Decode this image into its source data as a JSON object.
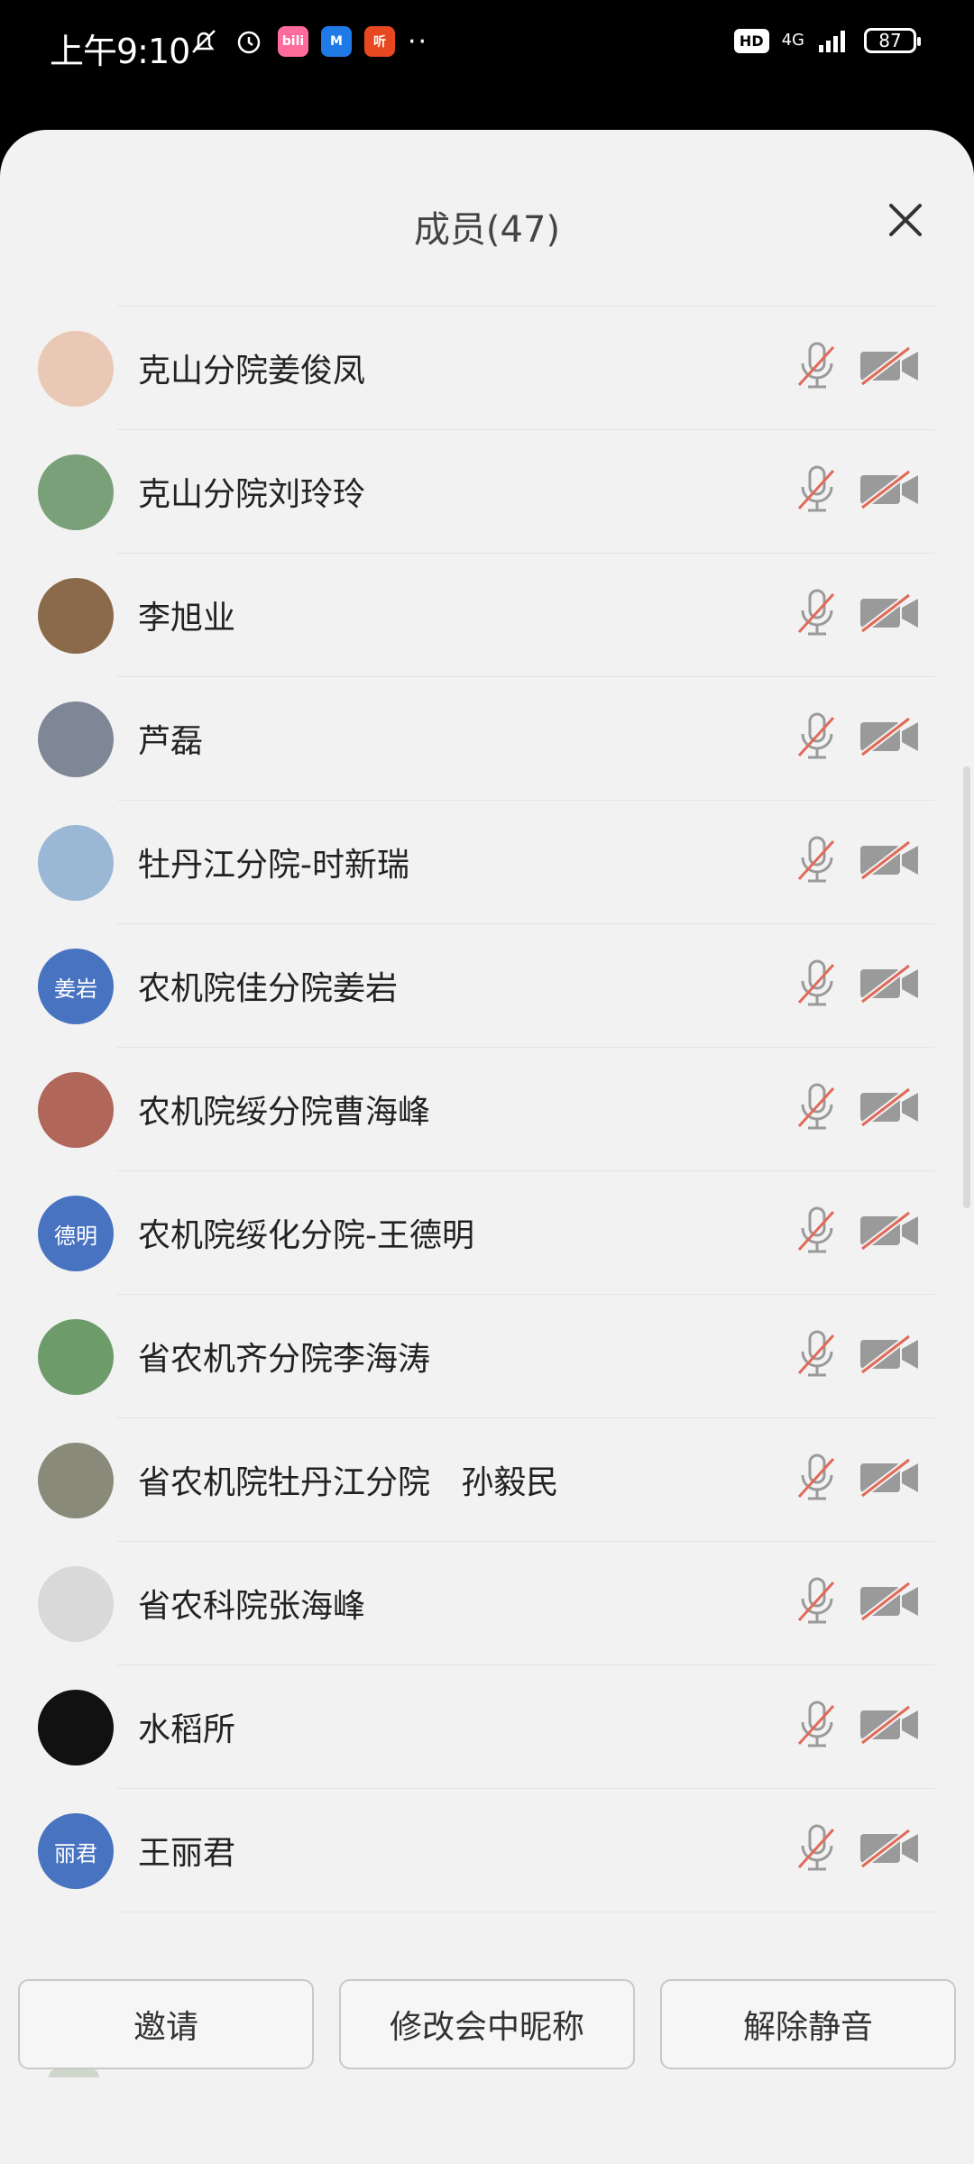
{
  "status_bar": {
    "time": "上午9:10",
    "apps": [
      {
        "name": "bilibili",
        "label": "bili",
        "color": "#ff6b9a"
      },
      {
        "name": "app-blue",
        "label": "M",
        "color": "#1f7ae8"
      },
      {
        "name": "ting",
        "label": "听",
        "color": "#e8481f"
      }
    ],
    "hd": "HD",
    "network": "4G",
    "battery": "87"
  },
  "sheet": {
    "title": "成员(47)"
  },
  "members": [
    {
      "name": "克山分院姜俊凤",
      "avatar_text": "",
      "avatar_color": "#e9c9b5"
    },
    {
      "name": "克山分院刘玲玲",
      "avatar_text": "",
      "avatar_color": "#7aa07a"
    },
    {
      "name": "李旭业",
      "avatar_text": "",
      "avatar_color": "#8a6a4a"
    },
    {
      "name": "芦磊",
      "avatar_text": "",
      "avatar_color": "#7d8796"
    },
    {
      "name": "牡丹江分院-时新瑞",
      "avatar_text": "",
      "avatar_color": "#9bb7d6"
    },
    {
      "name": "农机院佳分院姜岩",
      "avatar_text": "姜岩",
      "avatar_color": "#4873c0"
    },
    {
      "name": "农机院绥分院曹海峰",
      "avatar_text": "",
      "avatar_color": "#b1665a"
    },
    {
      "name": "农机院绥化分院-王德明",
      "avatar_text": "德明",
      "avatar_color": "#4873c0"
    },
    {
      "name": "省农机齐分院李海涛",
      "avatar_text": "",
      "avatar_color": "#6e9b6a"
    },
    {
      "name": "省农机院牡丹江分院   孙毅民",
      "avatar_text": "",
      "avatar_color": "#8a8a7a"
    },
    {
      "name": "省农科院张海峰",
      "avatar_text": "",
      "avatar_color": "#d9d9d9"
    },
    {
      "name": "水稻所",
      "avatar_text": "",
      "avatar_color": "#111111"
    },
    {
      "name": "王丽君",
      "avatar_text": "丽君",
      "avatar_color": "#4873c0"
    }
  ],
  "buttons": {
    "invite": "邀请",
    "rename": "修改会中昵称",
    "unmute": "解除静音"
  },
  "colors": {
    "mute_slash": "#e06a5a",
    "icon_gray": "#9a9a9a",
    "avatar_blue": "#4873c0"
  }
}
